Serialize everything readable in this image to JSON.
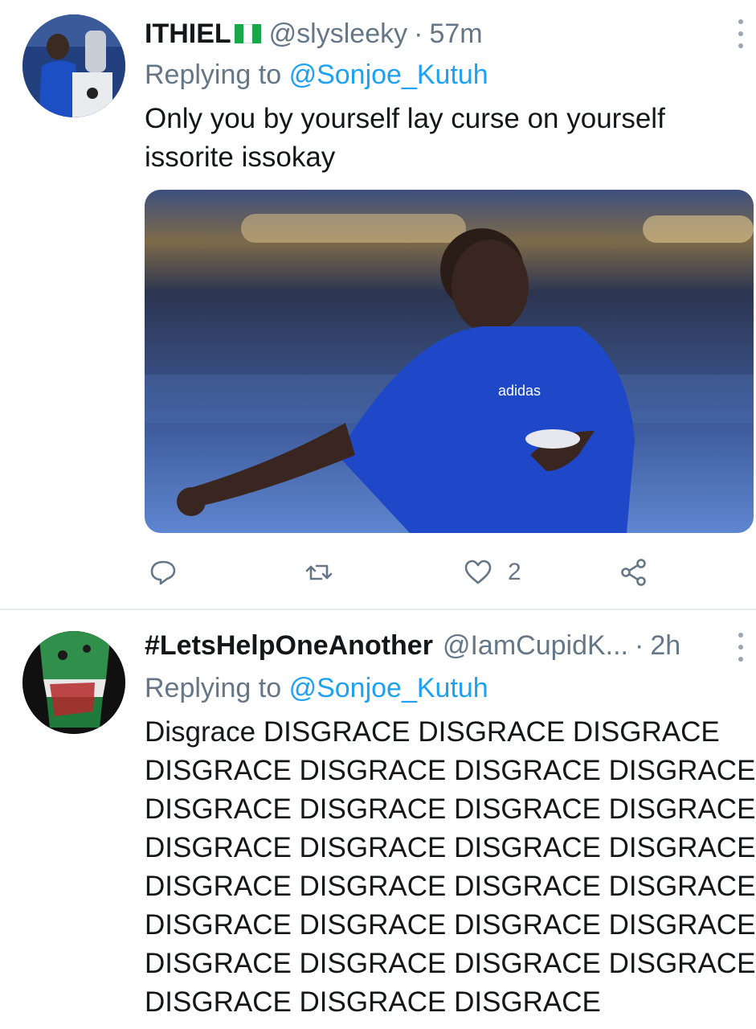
{
  "tweets": [
    {
      "name": "ITHIEL",
      "handle": "@slysleeky",
      "separator": "·",
      "time": "57m",
      "replying_prefix": "Replying to",
      "replying_to": "@Sonjoe_Kutuh",
      "lines": [
        "Only you by yourself lay curse on yourself",
        "issorite issokay"
      ],
      "likes": "2",
      "flag_colors": [
        "#18a84a",
        "#ffffff",
        "#18a84a"
      ]
    },
    {
      "name": "#LetsHelpOneAnother",
      "handle": "@IamCupidK...",
      "separator": "·",
      "time": "2h",
      "replying_prefix": "Replying to",
      "replying_to": "@Sonjoe_Kutuh",
      "lines": [
        "Disgrace DISGRACE DISGRACE DISGRACE",
        "DISGRACE DISGRACE DISGRACE DISGRACE",
        "DISGRACE DISGRACE DISGRACE DISGRACE",
        "DISGRACE DISGRACE DISGRACE DISGRACE",
        "DISGRACE DISGRACE DISGRACE DISGRACE",
        "DISGRACE DISGRACE DISGRACE DISGRACE",
        "DISGRACE DISGRACE DISGRACE DISGRACE",
        "DISGRACE DISGRACE DISGRACE"
      ]
    }
  ],
  "icons": {
    "reply": "reply-icon",
    "retweet": "retweet-icon",
    "like": "heart-icon",
    "share": "share-icon",
    "more": "more-vertical-icon"
  },
  "colors": {
    "link": "#1da1f2",
    "secondary": "#657786",
    "text": "#14171a",
    "divider": "#e6ecf0"
  }
}
